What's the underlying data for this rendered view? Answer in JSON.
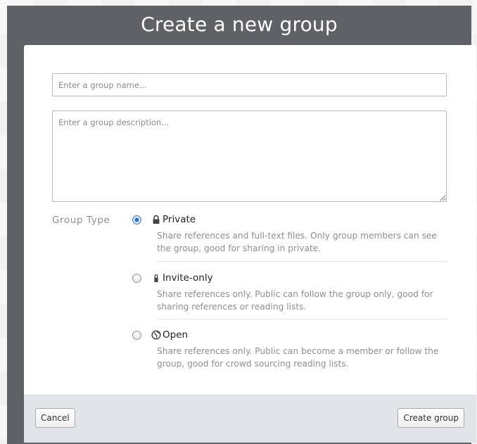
{
  "dialog": {
    "title": "Create a new group",
    "name_placeholder": "Enter a group name...",
    "description_placeholder": "Enter a group description..."
  },
  "group_type": {
    "label": "Group Type",
    "selected": "private",
    "options": [
      {
        "id": "private",
        "title": "Private",
        "icon": "lock-icon",
        "description": "Share references and full-text files. Only group members can see the group, good for sharing in private."
      },
      {
        "id": "invite-only",
        "title": "Invite-only",
        "icon": "padlock-icon",
        "description": "Share references only. Public can follow the group only, good for sharing references or reading lists."
      },
      {
        "id": "open",
        "title": "Open",
        "icon": "globe-icon",
        "description": "Share references only. Public can become a member or follow the group, good for crowd sourcing reading lists."
      }
    ]
  },
  "footer": {
    "cancel_label": "Cancel",
    "create_label": "Create group"
  },
  "colors": {
    "overlay": "#5e6266",
    "footer": "#e1e5e8",
    "radio_selected": "#2f6fb7",
    "muted_text": "#8f8f8f"
  }
}
